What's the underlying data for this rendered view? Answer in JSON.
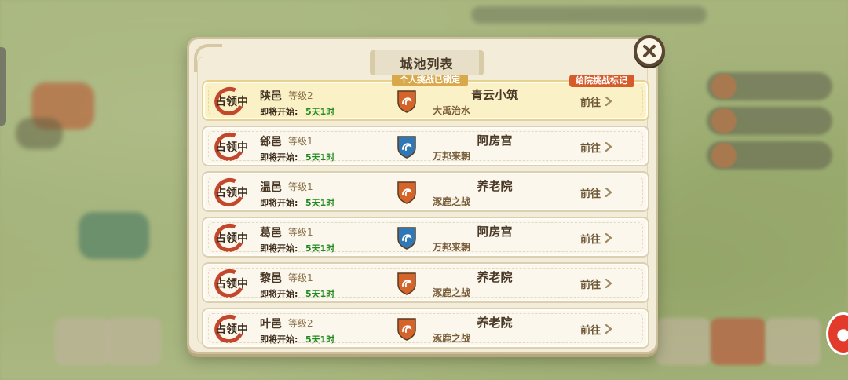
{
  "dialog": {
    "title": "城池列表",
    "close_icon": "close-icon"
  },
  "colors": {
    "accent_red": "#c3472c",
    "countdown_green": "#1f8a1f",
    "lock_ribbon": "#d8a84a",
    "mark_ribbon": "#d65a2a",
    "highlight_row": "#fbf1c6"
  },
  "cities": [
    {
      "status": "占领中",
      "name": "陕邑",
      "level": "等级2",
      "countdown_label": "即将开始:",
      "countdown_value": "5天1时",
      "faction_icon": "orange-crest-icon",
      "faction_color": "#d4642a",
      "faction_name": "青云小筑",
      "faction_motto": "大禹治水",
      "action": "前往",
      "lock_text": "个人挑战已锁定",
      "mark_text": "给院挑战标记"
    },
    {
      "status": "占领中",
      "name": "郐邑",
      "level": "等级1",
      "countdown_label": "即将开始:",
      "countdown_value": "5天1时",
      "faction_icon": "blue-crest-icon",
      "faction_color": "#2f78b5",
      "faction_name": "阿房宫",
      "faction_motto": "万邦来朝",
      "action": "前往"
    },
    {
      "status": "占领中",
      "name": "温邑",
      "level": "等级1",
      "countdown_label": "即将开始:",
      "countdown_value": "5天1时",
      "faction_icon": "orange-crest-icon",
      "faction_color": "#d4642a",
      "faction_name": "养老院",
      "faction_motto": "涿鹿之战",
      "action": "前往"
    },
    {
      "status": "占领中",
      "name": "葛邑",
      "level": "等级1",
      "countdown_label": "即将开始:",
      "countdown_value": "5天1时",
      "faction_icon": "blue-crest-icon",
      "faction_color": "#2f78b5",
      "faction_name": "阿房宫",
      "faction_motto": "万邦来朝",
      "action": "前往"
    },
    {
      "status": "占领中",
      "name": "黎邑",
      "level": "等级1",
      "countdown_label": "即将开始:",
      "countdown_value": "5天1时",
      "faction_icon": "orange-crest-icon",
      "faction_color": "#d4642a",
      "faction_name": "养老院",
      "faction_motto": "涿鹿之战",
      "action": "前往"
    },
    {
      "status": "占领中",
      "name": "叶邑",
      "level": "等级2",
      "countdown_label": "即将开始:",
      "countdown_value": "5天1时",
      "faction_icon": "orange-crest-icon",
      "faction_color": "#d4642a",
      "faction_name": "养老院",
      "faction_motto": "涿鹿之战",
      "action": "前往"
    }
  ]
}
